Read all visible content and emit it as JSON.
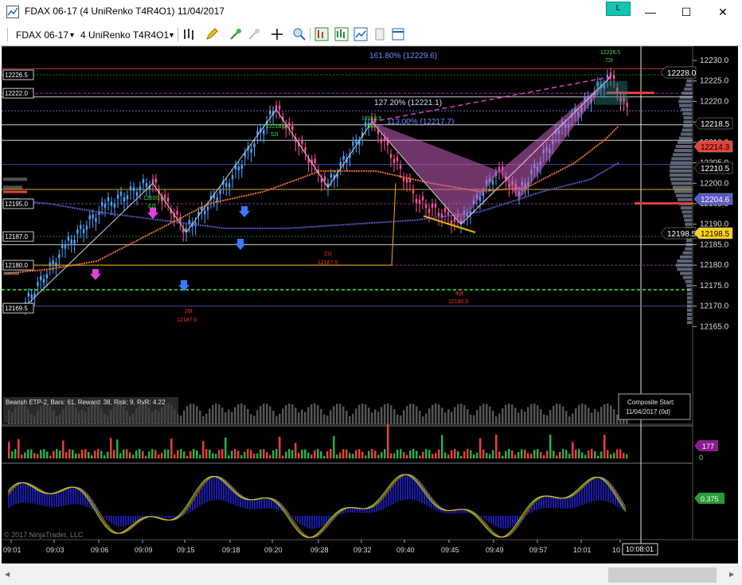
{
  "window": {
    "title": "FDAX 06-17 (4 UniRenko T4R4O1)  11/04/2017",
    "link_button": "L",
    "minimize": "—",
    "maximize": "☐",
    "close": "✕"
  },
  "toolbar": {
    "instrument": "FDAX 06-17",
    "bar_type": "4 UniRenko T4R4O1"
  },
  "chart": {
    "price_axis": [
      "12230.0",
      "12225.0",
      "12220.0",
      "12215.0",
      "12210.0",
      "12205.0",
      "12200.0",
      "12195.0",
      "12190.0",
      "12185.0",
      "12180.0",
      "12175.0",
      "12170.0",
      "12165.0"
    ],
    "time_axis": [
      "09:01",
      "09:03",
      "09:06",
      "09:09",
      "09:15",
      "09:18",
      "09:20",
      "09:28",
      "09:32",
      "09:40",
      "09:45",
      "09:49",
      "09:57",
      "10:01",
      "10"
    ],
    "current_time": "10:08:01",
    "price_tags": [
      {
        "label": "12228.0",
        "bg": "#000000",
        "fg": "#ffffff"
      },
      {
        "label": "12218.5",
        "bg": "#000000",
        "fg": "#ffffff"
      },
      {
        "label": "12214.3",
        "bg": "#e8413a",
        "fg": "#000000"
      },
      {
        "label": "12210.5",
        "bg": "#000000",
        "fg": "#ffffff"
      },
      {
        "label": "12204.6",
        "bg": "#5a57c8",
        "fg": "#ffffff"
      },
      {
        "label": "12198.5",
        "bg": "#000000",
        "fg": "#ffffff"
      },
      {
        "label": "12198.5",
        "bg": "#ffd21a",
        "fg": "#000000"
      }
    ],
    "left_level_labels": [
      "12226.5",
      "12222.0",
      "12195.0",
      "12187.0",
      "12180.0",
      "12169.5"
    ],
    "fib_levels": {
      "l161": "161.80% (12229.6)",
      "l127": "127.20% (12221.1)",
      "l113": "113.00% (12217.7)"
    },
    "swing_labels": {
      "s1_price": "12200.0",
      "s1_bars": "61t",
      "s2_price": "12218.0",
      "s2_bars": "52t",
      "s3_price": "12214.5",
      "s3_bars": "34t",
      "s4_price": "12226.5",
      "s4_bars": "72t",
      "s5_bars": "26t",
      "s5_price": "12187.0",
      "s6_bars": "21t",
      "s6_price": "12187.5",
      "s7_bars": "49t",
      "s7_price": "12180.5"
    },
    "pattern_info": "Bearish ETP-2, Bars: 61, Reward: 38, Risk: 9, RvR: 4.22",
    "composite": {
      "line1": "Composite Start:",
      "line2": "11/04/2017 (0d)"
    },
    "volume_panel": {
      "value": "177",
      "zero": "0",
      "accent": "#8a1b8e"
    },
    "oscillator_panel": {
      "value": "0.375",
      "accent": "#2a9a3a"
    },
    "copyright": "© 2017 NinjaTrader, LLC",
    "colors": {
      "up_bar": "#4aa3ff",
      "down_bar": "#ff4f9a",
      "pattern": "#c860c0",
      "accent_red": "#e8413a"
    }
  }
}
